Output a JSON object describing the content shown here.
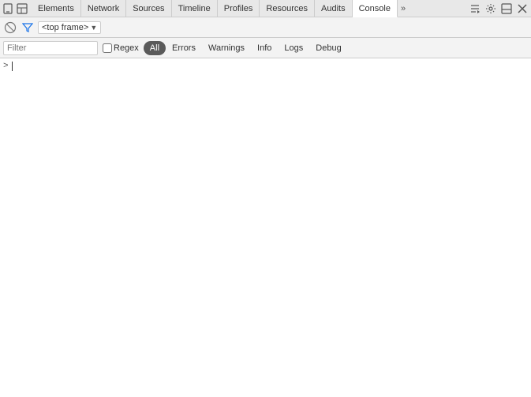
{
  "tabs": {
    "items": [
      {
        "label": "Elements",
        "active": false
      },
      {
        "label": "Network",
        "active": false
      },
      {
        "label": "Sources",
        "active": false
      },
      {
        "label": "Timeline",
        "active": false
      },
      {
        "label": "Profiles",
        "active": false
      },
      {
        "label": "Resources",
        "active": false
      },
      {
        "label": "Audits",
        "active": false
      },
      {
        "label": "Console",
        "active": true
      }
    ],
    "overflow_label": "»"
  },
  "toolbar": {
    "ban_icon": "🚫",
    "filter_icon": "⚙",
    "frame_label": "<top frame>",
    "frame_arrow": "▼"
  },
  "filter_bar": {
    "filter_placeholder": "Filter",
    "regex_label": "Regex",
    "levels": [
      {
        "label": "All",
        "active": true
      },
      {
        "label": "Errors",
        "active": false
      },
      {
        "label": "Warnings",
        "active": false
      },
      {
        "label": "Info",
        "active": false
      },
      {
        "label": "Logs",
        "active": false
      },
      {
        "label": "Debug",
        "active": false
      }
    ]
  },
  "console": {
    "prompt_caret": ">"
  },
  "icons": {
    "mobile": "☰",
    "inspect": "⬚",
    "run": "▶",
    "settings": "⚙",
    "dock": "⊟",
    "close": "✕"
  }
}
